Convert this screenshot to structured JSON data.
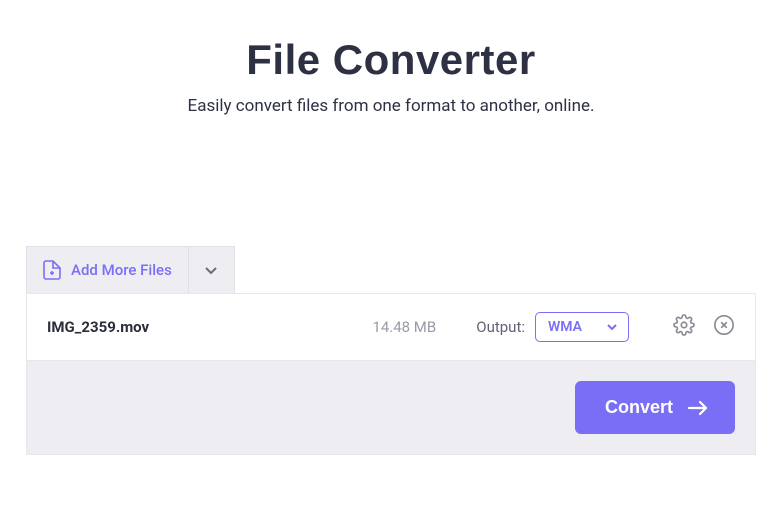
{
  "hero": {
    "title": "File Converter",
    "subtitle": "Easily convert files from one format to another, online."
  },
  "toolbar": {
    "add_more_label": "Add More Files"
  },
  "file": {
    "name": "IMG_2359.mov",
    "size": "14.48 MB",
    "output_label": "Output:",
    "format": "WMA"
  },
  "actions": {
    "convert_label": "Convert"
  }
}
